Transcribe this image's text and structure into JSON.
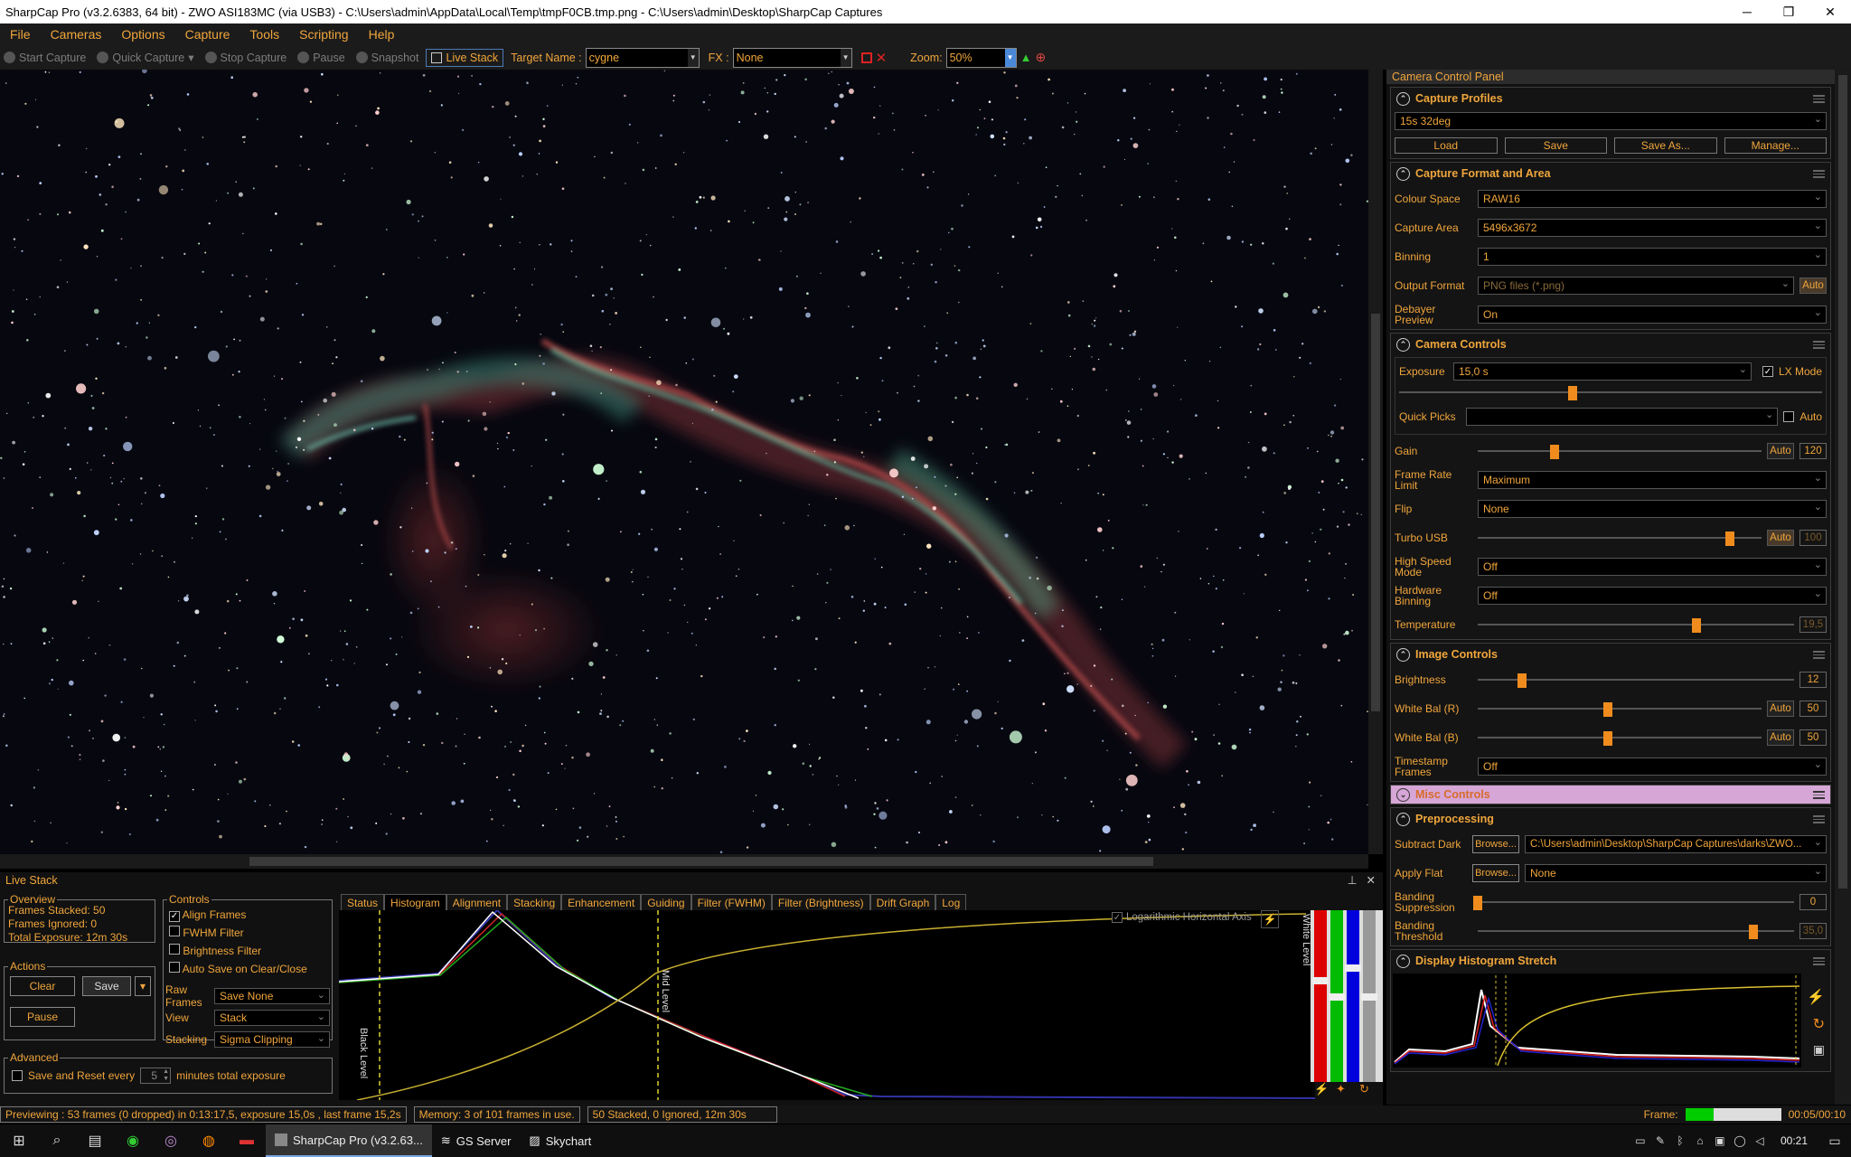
{
  "window": {
    "title": "SharpCap Pro (v3.2.6383, 64 bit) - ZWO ASI183MC (via USB3) - C:\\Users\\admin\\AppData\\Local\\Temp\\tmpF0CB.tmp.png - C:\\Users\\admin\\Desktop\\SharpCap Captures"
  },
  "menu": [
    "File",
    "Cameras",
    "Options",
    "Capture",
    "Tools",
    "Scripting",
    "Help"
  ],
  "toolbar": {
    "start_capture": "Start Capture",
    "quick_capture": "Quick Capture",
    "stop_capture": "Stop Capture",
    "pause": "Pause",
    "snapshot": "Snapshot",
    "live_stack": "Live Stack",
    "target_label": "Target Name :",
    "target_value": "cygne",
    "fx_label": "FX :",
    "fx_value": "None",
    "zoom_label": "Zoom:",
    "zoom_value": "50%"
  },
  "panel": {
    "title": "Camera Control Panel",
    "capture_profiles": {
      "title": "Capture Profiles",
      "profile": "15s 32deg",
      "buttons": [
        "Load",
        "Save",
        "Save As...",
        "Manage..."
      ]
    },
    "format": {
      "title": "Capture Format and Area",
      "colour_space_label": "Colour Space",
      "colour_space": "RAW16",
      "capture_area_label": "Capture Area",
      "capture_area": "5496x3672",
      "binning_label": "Binning",
      "binning": "1",
      "output_format_label": "Output Format",
      "output_format": "PNG files (*.png)",
      "output_auto": "Auto",
      "debayer_label": "Debayer Preview",
      "debayer": "On"
    },
    "camera": {
      "title": "Camera Controls",
      "exposure_label": "Exposure",
      "exposure": "15,0 s",
      "lx_mode": "LX Mode",
      "quick_picks_label": "Quick Picks",
      "quick_auto": "Auto",
      "gain_label": "Gain",
      "gain_auto": "Auto",
      "gain": "120",
      "gain_level": 0.27,
      "exposure_level": 0.41,
      "frame_rate_label": "Frame Rate Limit",
      "frame_rate": "Maximum",
      "flip_label": "Flip",
      "flip": "None",
      "turbo_label": "Turbo USB",
      "turbo_auto": "Auto",
      "turbo": "100",
      "turbo_level": 0.89,
      "hsm_label": "High Speed Mode",
      "hsm": "Off",
      "hwbin_label": "Hardware Binning",
      "hwbin": "Off",
      "temp_label": "Temperature",
      "temp": "19,5",
      "temp_level": 0.69
    },
    "image": {
      "title": "Image Controls",
      "brightness_label": "Brightness",
      "brightness": "12",
      "brightness_level": 0.14,
      "wbr_label": "White Bal (R)",
      "wbr_auto": "Auto",
      "wbr": "50",
      "wbr_level": 0.46,
      "wbb_label": "White Bal (B)",
      "wbb_auto": "Auto",
      "wbb": "50",
      "wbb_level": 0.46,
      "timestamp_label": "Timestamp Frames",
      "timestamp": "Off"
    },
    "misc": {
      "title": "Misc Controls"
    },
    "pre": {
      "title": "Preprocessing",
      "dark_label": "Subtract Dark",
      "browse": "Browse...",
      "dark_path": "C:\\Users\\admin\\Desktop\\SharpCap Captures\\darks\\ZWO...",
      "flat_label": "Apply Flat",
      "flat": "None",
      "band_sup_label": "Banding Suppression",
      "band_sup": "0",
      "band_sup_level": 0.0,
      "band_thr_label": "Banding Threshold",
      "band_thr": "35,0",
      "band_thr_level": 0.87
    },
    "dhs": {
      "title": "Display Histogram Stretch"
    }
  },
  "livestack": {
    "title": "Live Stack",
    "overview": {
      "title": "Overview",
      "stacked": "Frames Stacked:  50",
      "ignored": "Frames Ignored:  0",
      "total": "Total Exposure:   12m 30s"
    },
    "actions": {
      "title": "Actions",
      "clear": "Clear",
      "save": "Save",
      "pause": "Pause"
    },
    "controls": {
      "title": "Controls",
      "align": "Align Frames",
      "fwhm": "FWHM Filter",
      "bright": "Brightness Filter",
      "autosave": "Auto Save on Clear/Close",
      "raw_label": "Raw Frames",
      "raw": "Save None",
      "view_label": "View",
      "view": "Stack",
      "stacking_label": "Stacking",
      "stacking": "Sigma Clipping"
    },
    "advanced": {
      "title": "Advanced",
      "save_reset": "Save and Reset every",
      "minutes": "5",
      "minutes_suffix": "minutes total exposure"
    },
    "tabs": [
      "Status",
      "Histogram",
      "Alignment",
      "Stacking",
      "Enhancement",
      "Guiding",
      "Filter (FWHM)",
      "Filter (Brightness)",
      "Drift Graph",
      "Log"
    ],
    "log_axis": "Logarithmic Horizontal Axis",
    "black_level": "Black Level",
    "mid_level": "Mid Level",
    "white_level": "White Level"
  },
  "status": {
    "preview": "Previewing : 53 frames (0 dropped) in 0:13:17,5, exposure 15,0s , last frame 15,2s",
    "memory": "Memory: 3 of 101 frames in use.",
    "stacked": "50 Stacked, 0 Ignored, 12m 30s",
    "frame_label": "Frame:",
    "frame_time": "00:05/00:10",
    "frame_progress": 0.3
  },
  "taskbar": {
    "tasks": [
      "SharpCap Pro (v3.2.63...",
      "GS Server",
      "Skychart"
    ],
    "clock": "00:21"
  }
}
